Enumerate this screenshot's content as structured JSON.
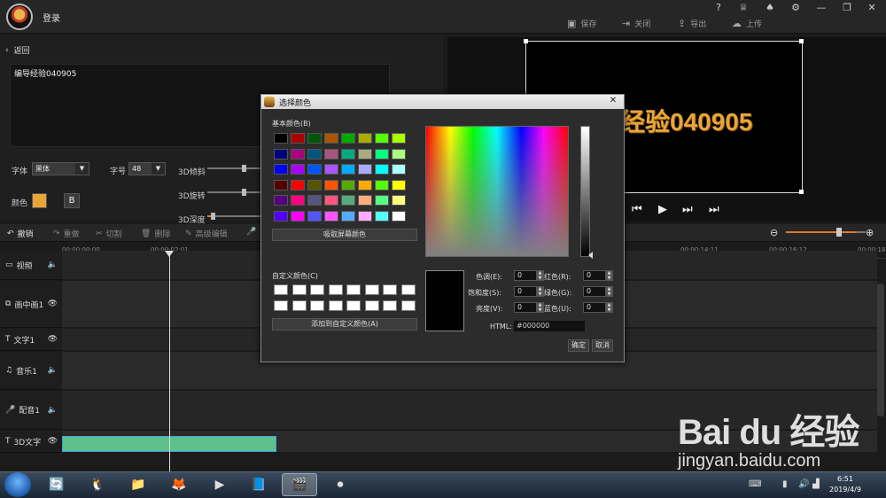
{
  "header": {
    "login": "登录",
    "window_controls": [
      "?",
      "♕",
      "♠",
      "⚙",
      "—",
      "❐",
      "✕"
    ],
    "actions": [
      {
        "label": "保存",
        "icon": "save-icon"
      },
      {
        "label": "关闭",
        "icon": "exit-icon"
      },
      {
        "label": "导出",
        "icon": "export-icon"
      },
      {
        "label": "上传",
        "icon": "upload-icon"
      }
    ]
  },
  "editor": {
    "back_label": "返回",
    "text_content": "编导经验040905",
    "font_label": "字体",
    "font_value": "黑体",
    "size_label": "字号",
    "size_value": "48",
    "tilt_label": "3D倾斜",
    "rotate_label": "3D旋转",
    "depth_label": "3D深度",
    "color_label": "颜色",
    "bold_label": "B",
    "color_value": "#e8a63a"
  },
  "preview": {
    "text": "经验040905"
  },
  "toolbar": {
    "undo": "撤销",
    "redo": "重做",
    "cut": "切割",
    "delete": "删除",
    "advanced_edit": "高级编辑"
  },
  "timeline": {
    "ticks": [
      "00:00:00:00",
      "00:00:02:01",
      "00:00:14:11",
      "00:00:16:12",
      "00:00:18:"
    ],
    "tracks": [
      {
        "label": "视频",
        "icon": "video-icon"
      },
      {
        "label": "画中画1",
        "icon": "pip-icon"
      },
      {
        "label": "文字1",
        "icon": "text-icon"
      },
      {
        "label": "音乐1",
        "icon": "music-icon"
      },
      {
        "label": "配音1",
        "icon": "mic-icon"
      },
      {
        "label": "3D文字",
        "icon": "text-icon"
      }
    ]
  },
  "color_dialog": {
    "title": "选择颜色",
    "basic_colors_label": "基本颜色(B)",
    "basic_colors": [
      "#000000",
      "#aa0000",
      "#00550a",
      "#aa5500",
      "#00aa00",
      "#aaaa00",
      "#55ff00",
      "#aaff00",
      "#00007f",
      "#aa007f",
      "#00557f",
      "#aa557f",
      "#00aa7f",
      "#aaaa7f",
      "#00ff7f",
      "#aaff7f",
      "#0000ff",
      "#aa00ff",
      "#0055ff",
      "#aa55ff",
      "#00aaff",
      "#aaaaff",
      "#00ffff",
      "#aaffff",
      "#550000",
      "#ff0000",
      "#555500",
      "#ff5500",
      "#55aa00",
      "#ffaa00",
      "#55ff00",
      "#ffff00",
      "#55007f",
      "#ff007f",
      "#55557f",
      "#ff557f",
      "#55aa7f",
      "#ffaa7f",
      "#55ff7f",
      "#ffff7f",
      "#5500ff",
      "#ff00ff",
      "#5555ff",
      "#ff55ff",
      "#55aaff",
      "#ffaaff",
      "#55ffff",
      "#ffffff"
    ],
    "pick_screen_label": "吸取屏幕颜色",
    "custom_colors_label": "自定义颜色(C)",
    "add_custom_label": "添加到自定义颜色(A)",
    "fields": [
      {
        "label": "色调(E):",
        "value": "0"
      },
      {
        "label": "饱和度(S):",
        "value": "0"
      },
      {
        "label": "亮度(V):",
        "value": "0"
      },
      {
        "label": "红色(R):",
        "value": "0"
      },
      {
        "label": "绿色(G):",
        "value": "0"
      },
      {
        "label": "蓝色(U):",
        "value": "0"
      }
    ],
    "html_label": "HTML:",
    "html_value": "#000000",
    "ok": "确定",
    "cancel": "取消"
  },
  "watermark": {
    "logo": "Bai du 经验",
    "url": "jingyan.baidu.com"
  },
  "taskbar": {
    "time": "6:51",
    "date": "2019/4/9"
  }
}
